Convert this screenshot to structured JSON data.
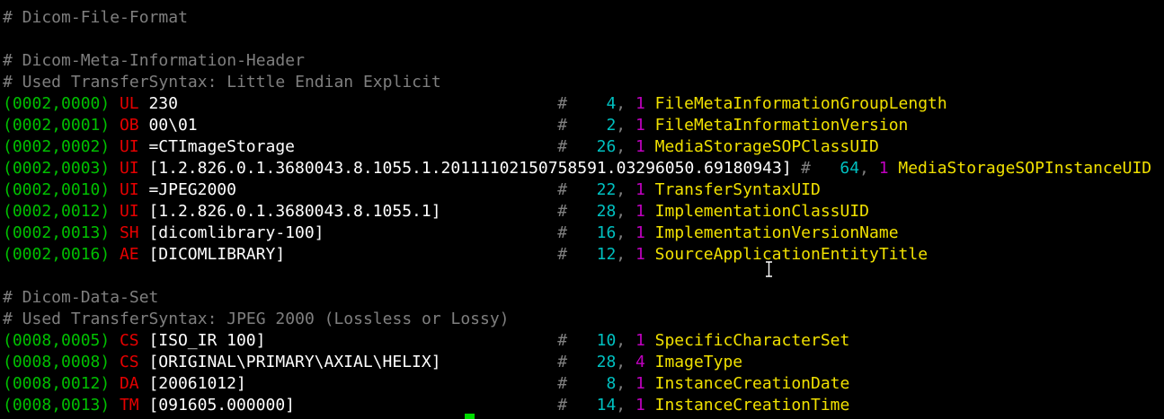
{
  "comments": {
    "file_format": "# Dicom-File-Format",
    "meta_header": "# Dicom-Meta-Information-Header",
    "meta_syntax": "# Used TransferSyntax: Little Endian Explicit",
    "data_set": "# Dicom-Data-Set",
    "data_syntax": "# Used TransferSyntax: JPEG 2000 (Lossless or Lossy)"
  },
  "meta_rows": [
    {
      "tag": "(0002,0000)",
      "vr": "UL",
      "value": "230",
      "length": "4",
      "mult": "1",
      "keyword": "FileMetaInformationGroupLength"
    },
    {
      "tag": "(0002,0001)",
      "vr": "OB",
      "value": "00\\01",
      "length": "2",
      "mult": "1",
      "keyword": "FileMetaInformationVersion"
    },
    {
      "tag": "(0002,0002)",
      "vr": "UI",
      "value": "=CTImageStorage",
      "length": "26",
      "mult": "1",
      "keyword": "MediaStorageSOPClassUID"
    },
    {
      "tag": "(0002,0003)",
      "vr": "UI",
      "value": "[1.2.826.0.1.3680043.8.1055.1.20111102150758591.03296050.69180943]",
      "length": "64",
      "mult": "1",
      "keyword": "MediaStorageSOPInstanceUID"
    },
    {
      "tag": "(0002,0010)",
      "vr": "UI",
      "value": "=JPEG2000",
      "length": "22",
      "mult": "1",
      "keyword": "TransferSyntaxUID"
    },
    {
      "tag": "(0002,0012)",
      "vr": "UI",
      "value": "[1.2.826.0.1.3680043.8.1055.1]",
      "length": "28",
      "mult": "1",
      "keyword": "ImplementationClassUID"
    },
    {
      "tag": "(0002,0013)",
      "vr": "SH",
      "value": "[dicomlibrary-100]",
      "length": "16",
      "mult": "1",
      "keyword": "ImplementationVersionName"
    },
    {
      "tag": "(0002,0016)",
      "vr": "AE",
      "value": "[DICOMLIBRARY]",
      "length": "12",
      "mult": "1",
      "keyword": "SourceApplicationEntityTitle"
    }
  ],
  "data_rows": [
    {
      "tag": "(0008,0005)",
      "vr": "CS",
      "value": "[ISO_IR 100]",
      "length": "10",
      "mult": "1",
      "keyword": "SpecificCharacterSet"
    },
    {
      "tag": "(0008,0008)",
      "vr": "CS",
      "value": "[ORIGINAL\\PRIMARY\\AXIAL\\HELIX]",
      "length": "28",
      "mult": "4",
      "keyword": "ImageType"
    },
    {
      "tag": "(0008,0012)",
      "vr": "DA",
      "value": "[20061012]",
      "length": "8",
      "mult": "1",
      "keyword": "InstanceCreationDate"
    },
    {
      "tag": "(0008,0013)",
      "vr": "TM",
      "value": "[091605.000000]",
      "length": "14",
      "mult": "1",
      "keyword": "InstanceCreationTime"
    }
  ],
  "colors": {
    "background": "#000000",
    "comment": "#7f7f7f",
    "tag": "#00c000",
    "vr": "#e60000",
    "length": "#00c0c0",
    "multiplicity": "#c000c0",
    "keyword": "#f0e000",
    "cursor": "#00dd00"
  },
  "icons": {
    "text_cursor": "ibeam-cursor-icon",
    "terminal_cursor": "block-cursor"
  }
}
